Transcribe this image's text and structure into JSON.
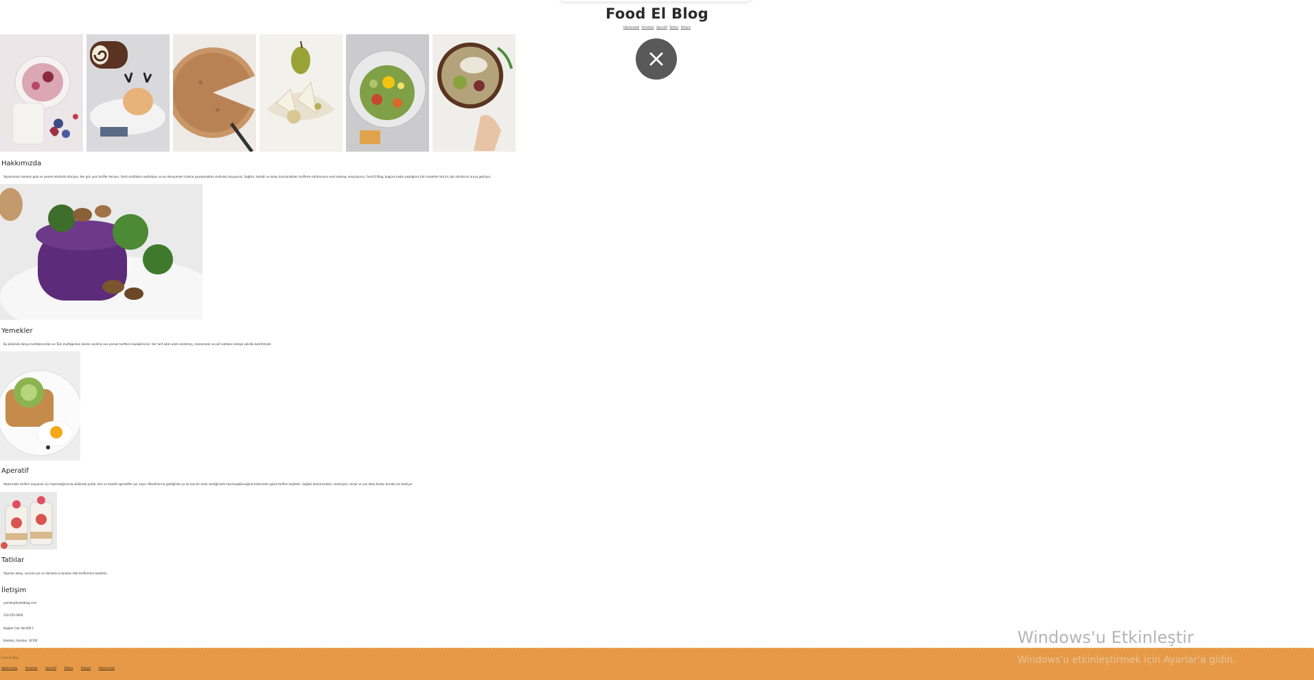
{
  "site": {
    "title": "Food El Blog"
  },
  "nav": {
    "items": [
      "Hakkımızda",
      "Yemekler",
      "Aperatif",
      "Tatlılar",
      "İletişim"
    ]
  },
  "close_button": {
    "label": "close",
    "icon": "close-icon"
  },
  "sections": {
    "about": {
      "title": "Hakkımızda",
      "text": "Yaşamımızın tamamı gıda ve yemek etrafında dönüyor. Her gün yeni tarifler deniyor, farklı mutfakları keşfediyor ve bu deneyimleri sizlerle paylaşmaktan mutluluk duyuyoruz. Sağlıklı, lezzetli ve kolay hazırlanabilen tariflerle sofralarınıza renk katmayı amaçlıyoruz. Food El Blog, bugüne kadar yaptığımız tüm lezzetleri tek bir çatı altında bir araya getiriyor."
    },
    "meals": {
      "title": "Yemekler",
      "text": "Bu bölümde dünya mutfaklarından ve Türk mutfağından özenle seçilmiş ana yemek tariflerini bulabilirsiniz. Her tarif adım adım anlatılmış, malzemeler ve püf noktaları detaylı şekilde belirtilmiştir."
    },
    "appetizer": {
      "title": "Aperatif",
      "text": "Atıştırmalık tarifleri arayanlar için hazırladığımız bu bölümde pratik, hızlı ve lezzetli aperatifler yer alıyor. Misafirleriniz geldiğinde ya da kısa bir mola verdiğinizde hazırlayabileceğiniz birbirinden güzel tarifleri keşfedin. Sağlıklı atıştırmalıklar, sandviçler, soslar ve çok daha fazlası burada sizi bekliyor."
    },
    "desserts": {
      "title": "Tatlılar",
      "text": "Yapması kolay, sunumu şık ve damakta iz bırakan tatlı tariflerimizi keşfedin."
    },
    "contact": {
      "title": "İletişim",
      "lines": [
        "yemek@foodelblog.com",
        "216-555-0000",
        "Bağdat Cad. No:000 1",
        "Kadıköy, İstanbul, 34700"
      ]
    }
  },
  "footer": {
    "brand": "Food El Blog",
    "links": [
      "Hakkımızda",
      "Yemekler",
      "Aperatif",
      "Tatlılar",
      "İletişim",
      "Hakkımızda"
    ],
    "background": "#e69a47"
  },
  "watermark": {
    "title": "Windows'u Etkinleştir",
    "subtitle": "Windows'u etkinleştirmek için Ayarlar'a gidin."
  }
}
